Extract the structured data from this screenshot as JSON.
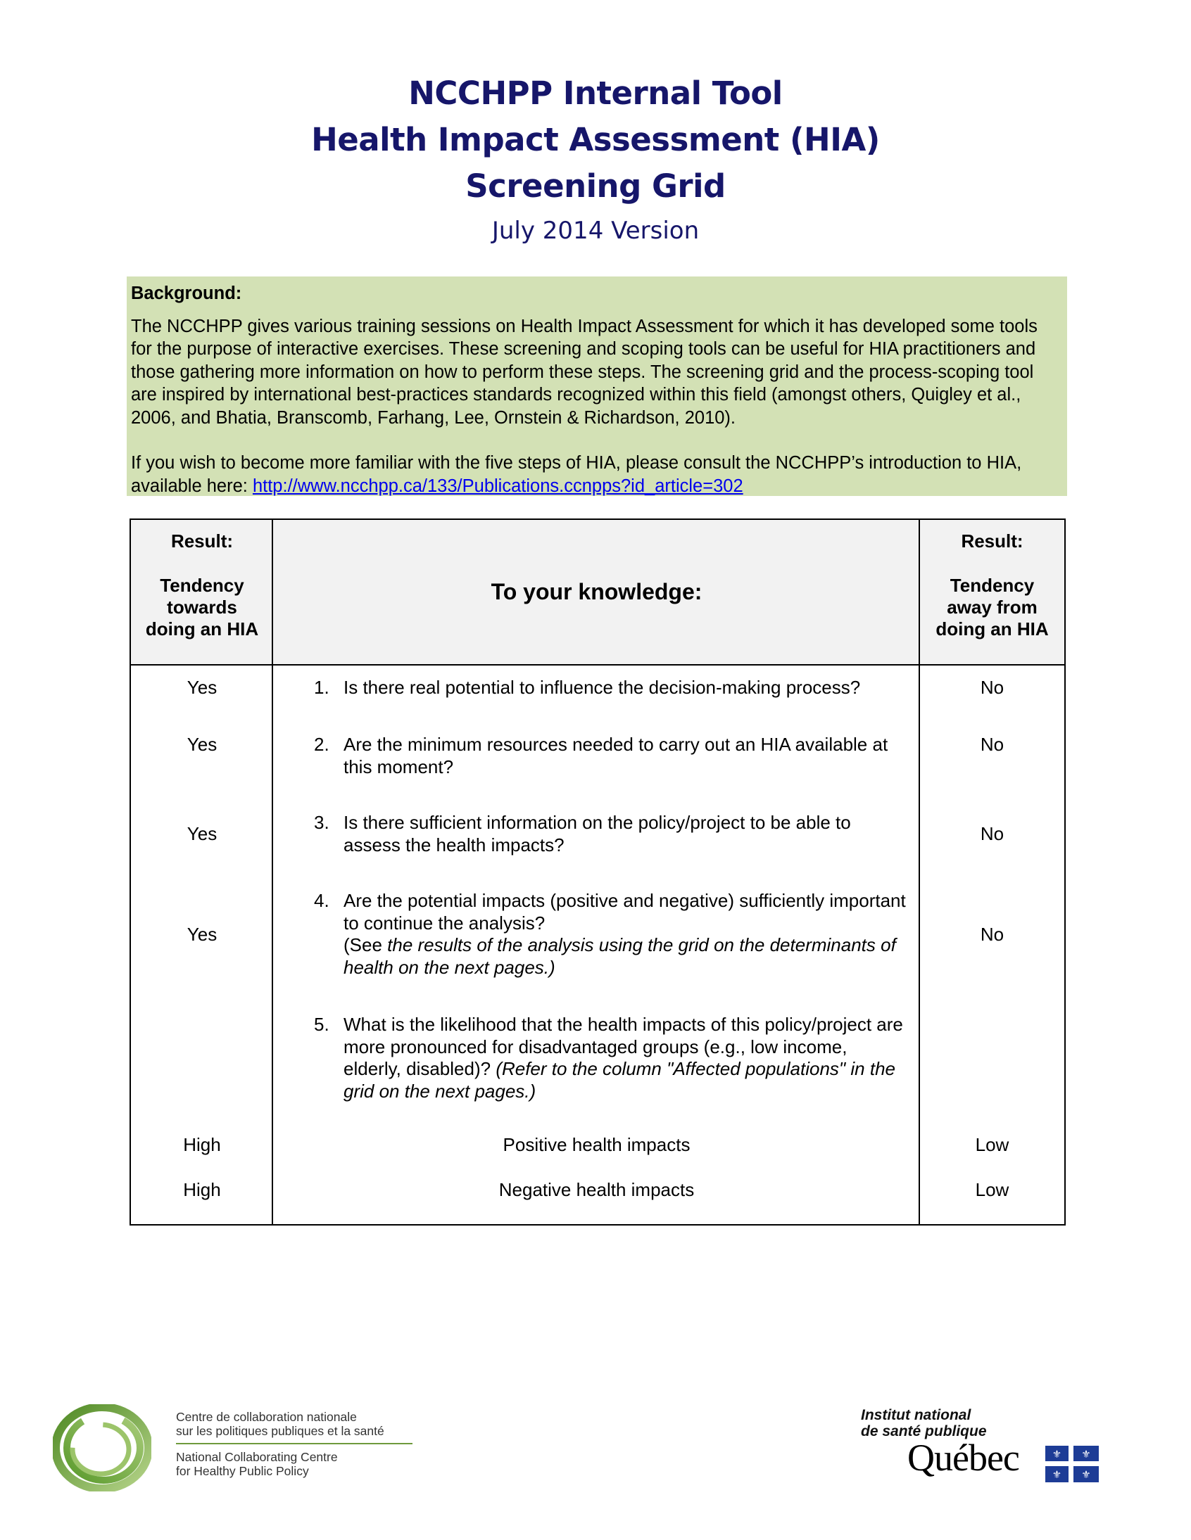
{
  "title": {
    "lines": [
      "NCCHPP Internal Tool",
      "Health Impact Assessment (HIA)",
      "Screening Grid"
    ],
    "version": "July 2014 Version",
    "color": "#16166a"
  },
  "background": {
    "heading": "Background:",
    "paragraph1": "The NCCHPP gives various training sessions on Health Impact Assessment for which it has developed some tools for the purpose of interactive exercises.  These screening and scoping tools can be useful for HIA practitioners and those gathering more information on how to perform these steps.  The screening grid and the process-scoping tool are inspired by international best-practices standards recognized within this field (amongst others, Quigley et al., 2006, and Bhatia, Branscomb, Farhang, Lee, Ornstein & Richardson, 2010).",
    "paragraph2_prefix": "If you wish to become more familiar with the five steps of HIA, please consult the NCCHPP’s introduction to HIA, available here: ",
    "link_text": "http://www.ncchpp.ca/133/Publications.ccnpps?id_article=302",
    "box_color": "#d3e1b5"
  },
  "grid": {
    "header": {
      "left": {
        "label": "Result:",
        "sub": [
          "Tendency",
          "towards",
          "doing an HIA"
        ]
      },
      "middle": "To your knowledge:",
      "right": {
        "label": "Result:",
        "sub": [
          "Tendency",
          "away from",
          "doing an HIA"
        ]
      }
    },
    "rows": [
      {
        "num": "1.",
        "text": "Is there real potential to influence the decision-making process?",
        "note_prefix": "",
        "note": "",
        "left": "Yes",
        "right": "No"
      },
      {
        "num": "2.",
        "text": "Are the minimum resources needed to carry out an HIA available at this moment?",
        "note_prefix": "",
        "note": "",
        "left": "Yes",
        "right": "No"
      },
      {
        "num": "3.",
        "text": "Is there sufficient information on the policy/project to be able to assess the health impacts?",
        "note_prefix": "",
        "note": "",
        "left": "Yes",
        "right": "No"
      },
      {
        "num": "4.",
        "text": "Are the potential impacts (positive and negative) sufficiently important to continue the analysis?",
        "note_prefix": "(See ",
        "note": "the results of the analysis using the grid on the determinants of health on the next pages.)",
        "left": "Yes",
        "right": "No"
      },
      {
        "num": "5.",
        "text": "What is the likelihood that the health impacts of this policy/project are more pronounced for disadvantaged groups (e.g., low income, elderly, disabled)? ",
        "note_prefix": "",
        "note": "(Refer to the column \"Affected populations\" in the grid on the next pages.)",
        "left": "",
        "right": ""
      }
    ],
    "impacts": [
      {
        "label": "Positive health impacts",
        "left": "High",
        "right": "Low"
      },
      {
        "label": "Negative health impacts",
        "left": "High",
        "right": "Low"
      }
    ]
  },
  "footer": {
    "ncchpp": {
      "fr_line1": "Centre de collaboration nationale",
      "fr_line2": "sur les politiques publiques et la santé",
      "en_line1": "National Collaborating Centre",
      "en_line2": "for Healthy Public Policy",
      "logo_icon": "green-swirl-logo-icon"
    },
    "inspq": {
      "line1": "Institut national",
      "line2": "de santé publique",
      "province": "Québec",
      "flag_icon": "quebec-fleurdelise-flag-icon"
    }
  }
}
